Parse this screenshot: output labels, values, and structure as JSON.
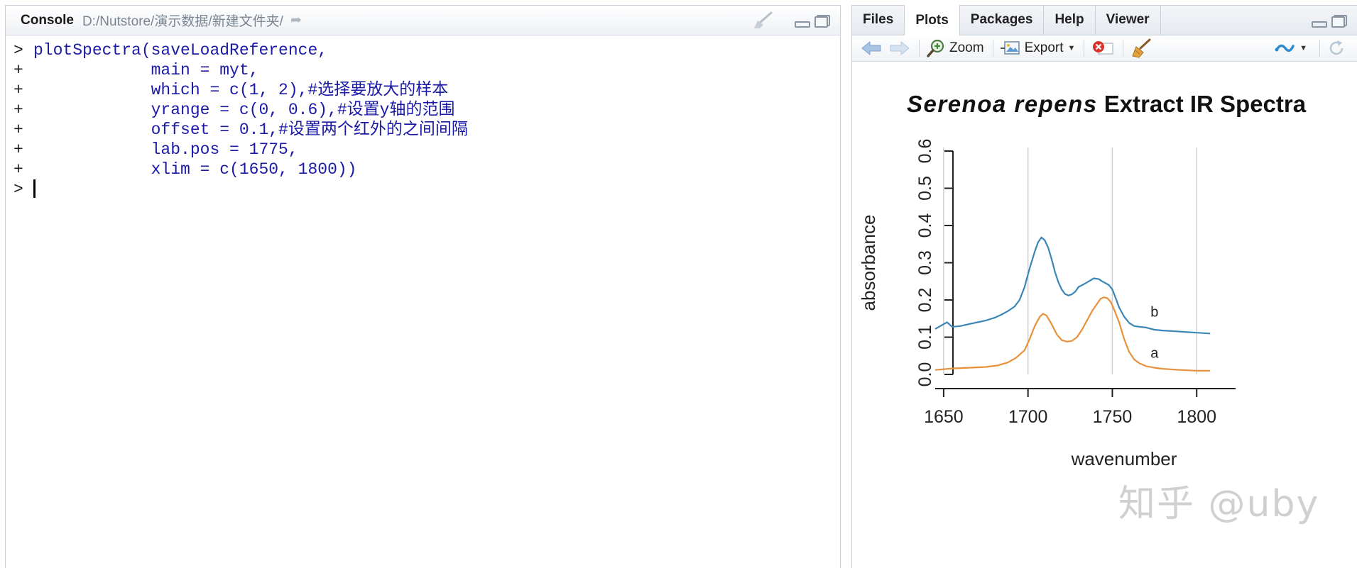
{
  "console": {
    "title": "Console",
    "path": "D:/Nutstore/演示数据/新建文件夹/",
    "lines": [
      {
        "prompt": ">",
        "code": "plotSpectra(saveLoadReference,"
      },
      {
        "prompt": "+",
        "code": "            main = myt,"
      },
      {
        "prompt": "+",
        "code": "            which = c(1, 2),#选择要放大的样本"
      },
      {
        "prompt": "+",
        "code": "            yrange = c(0, 0.6),#设置y轴的范围"
      },
      {
        "prompt": "+",
        "code": "            offset = 0.1,#设置两个红外的之间间隔"
      },
      {
        "prompt": "+",
        "code": "            lab.pos = 1775,"
      },
      {
        "prompt": "+",
        "code": "            xlim = c(1650, 1800))"
      },
      {
        "prompt": ">",
        "code": ""
      }
    ]
  },
  "tabs": [
    {
      "label": "Files",
      "active": false
    },
    {
      "label": "Plots",
      "active": true
    },
    {
      "label": "Packages",
      "active": false
    },
    {
      "label": "Help",
      "active": false
    },
    {
      "label": "Viewer",
      "active": false
    }
  ],
  "toolbar": {
    "zoom_label": "Zoom",
    "export_label": "Export"
  },
  "watermark": "知乎 @uby",
  "chart_data": {
    "type": "line",
    "title_italic": "Serenoa repens",
    "title_rest": " Extract IR Spectra",
    "xlabel": "wavenumber",
    "ylabel": "absorbance",
    "xlim": [
      1645,
      1810
    ],
    "ylim": [
      0,
      0.6
    ],
    "xticks": [
      1650,
      1700,
      1750,
      1800
    ],
    "yticks": [
      0.0,
      0.1,
      0.2,
      0.3,
      0.4,
      0.5,
      0.6
    ],
    "grid_x": [
      1650,
      1700,
      1750,
      1800
    ],
    "series": [
      {
        "name": "a",
        "color": "#e8913a",
        "label_x": 1775,
        "label_y": 0.045,
        "x": [
          1645,
          1655,
          1665,
          1675,
          1682,
          1688,
          1693,
          1698,
          1701,
          1704,
          1707,
          1709,
          1711,
          1714,
          1717,
          1720,
          1723,
          1726,
          1729,
          1732,
          1735,
          1738,
          1741,
          1743,
          1745,
          1747,
          1749,
          1751,
          1754,
          1757,
          1760,
          1763,
          1766,
          1770,
          1775,
          1780,
          1790,
          1800,
          1808
        ],
        "y": [
          0.012,
          0.016,
          0.018,
          0.02,
          0.024,
          0.032,
          0.045,
          0.065,
          0.095,
          0.13,
          0.155,
          0.163,
          0.158,
          0.135,
          0.108,
          0.092,
          0.088,
          0.09,
          0.1,
          0.12,
          0.145,
          0.17,
          0.19,
          0.203,
          0.207,
          0.205,
          0.195,
          0.175,
          0.14,
          0.095,
          0.06,
          0.04,
          0.03,
          0.022,
          0.018,
          0.015,
          0.012,
          0.01,
          0.01
        ]
      },
      {
        "name": "b",
        "color": "#3a86b6",
        "label_x": 1775,
        "label_y": 0.155,
        "x": [
          1645,
          1648,
          1652,
          1655,
          1660,
          1665,
          1670,
          1675,
          1680,
          1684,
          1688,
          1692,
          1695,
          1698,
          1701,
          1704,
          1706,
          1708,
          1710,
          1712,
          1714,
          1716,
          1718,
          1720,
          1722,
          1724,
          1726,
          1728,
          1730,
          1733,
          1736,
          1739,
          1742,
          1744,
          1746,
          1748,
          1750,
          1752,
          1754,
          1757,
          1760,
          1763,
          1766,
          1770,
          1775,
          1780,
          1790,
          1800,
          1808
        ],
        "y": [
          0.122,
          0.13,
          0.14,
          0.128,
          0.13,
          0.135,
          0.14,
          0.145,
          0.152,
          0.16,
          0.17,
          0.182,
          0.2,
          0.235,
          0.285,
          0.33,
          0.355,
          0.368,
          0.36,
          0.34,
          0.31,
          0.275,
          0.248,
          0.228,
          0.216,
          0.212,
          0.215,
          0.222,
          0.235,
          0.242,
          0.25,
          0.258,
          0.256,
          0.25,
          0.245,
          0.24,
          0.228,
          0.205,
          0.18,
          0.155,
          0.138,
          0.13,
          0.128,
          0.126,
          0.12,
          0.118,
          0.115,
          0.112,
          0.11
        ]
      }
    ]
  }
}
